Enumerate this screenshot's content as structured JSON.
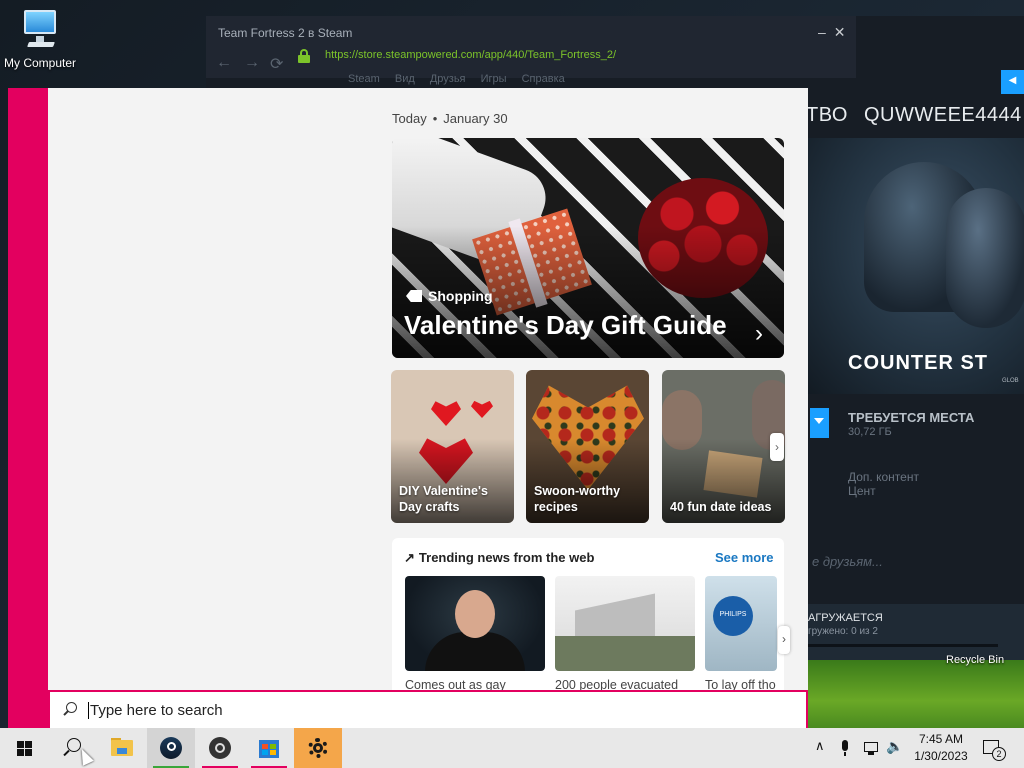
{
  "desktop": {
    "icon_label": "My Computer",
    "recycle_label": "Recycle Bin"
  },
  "steam": {
    "window_title": "Team Fortress 2 в Steam",
    "url": "https://store.steampowered.com/app/440/Team_Fortress_2/",
    "menu": [
      "Steam",
      "Вид",
      "Друзья",
      "Игры",
      "Справка"
    ],
    "header_left": "ТВО",
    "header_user": "QUWWEEE4444",
    "game_logo": "COUNTER ST",
    "game_logo_sub": "GLOB",
    "required_space_label": "ТРЕБУЕТСЯ МЕСТА",
    "required_space_value": "30,72 ГБ",
    "tabs": [
      "Доп. контент",
      "Цент"
    ],
    "friends_text": "е друзьям...",
    "download_status": "АГРУЖАЕТСЯ",
    "download_progress": "гружено: 0 из 2"
  },
  "news": {
    "date_today": "Today",
    "date": "January 30",
    "hero": {
      "category": "Shopping",
      "title": "Valentine's Day Gift Guide"
    },
    "cards": [
      {
        "caption": "DIY Valentine's Day crafts"
      },
      {
        "caption": "Swoon-worthy recipes"
      },
      {
        "caption": "40 fun date ideas"
      }
    ],
    "trending": {
      "title": "Trending news from the web",
      "see_more": "See more",
      "thumb_brand": "PHILIPS",
      "items": [
        {
          "caption": "Comes out as gay"
        },
        {
          "caption": "200 people evacuated"
        },
        {
          "caption": "To lay off tho"
        }
      ]
    }
  },
  "search": {
    "placeholder": "Type here to search"
  },
  "taskbar": {
    "time": "7:45 AM",
    "date": "1/30/2023",
    "notification_count": "2",
    "accent_colors": {
      "steam": "#3aa63a",
      "obs": "#e3005f",
      "store": "#e3005f"
    }
  },
  "colors": {
    "panel_accent": "#e3005f",
    "see_more": "#1a78c2",
    "url_green": "#7cc42a"
  }
}
